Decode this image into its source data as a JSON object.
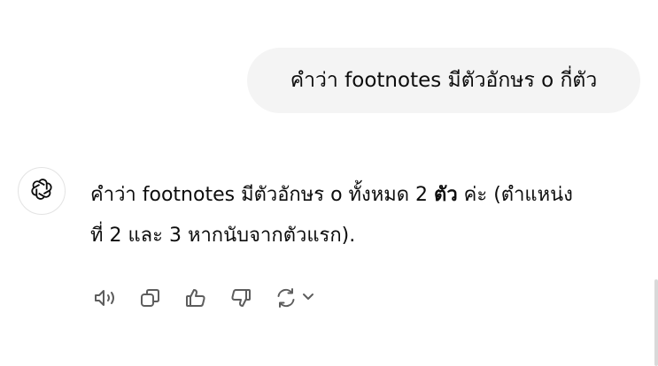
{
  "user_message": {
    "text": "คำว่า footnotes มีตัวอักษร o กี่ตัว"
  },
  "assistant_message": {
    "line1_before": "คำว่า footnotes มีตัวอักษร o ทั้งหมด 2 ",
    "line1_bold": "ตัว",
    "line1_after": " ค่ะ (ตำแหน่ง",
    "line2": "ที่ 2 และ 3 หากนับจากตัวแรก)."
  },
  "icons": {
    "avatar": "openai-logo-icon",
    "read_aloud": "speaker-icon",
    "copy": "copy-icon",
    "like": "thumbs-up-icon",
    "dislike": "thumbs-down-icon",
    "regenerate": "refresh-icon",
    "model_menu": "chevron-down-icon"
  },
  "colors": {
    "bubble_bg": "#f4f4f4",
    "text": "#0d0d0d",
    "icon": "#5d5d5d"
  }
}
